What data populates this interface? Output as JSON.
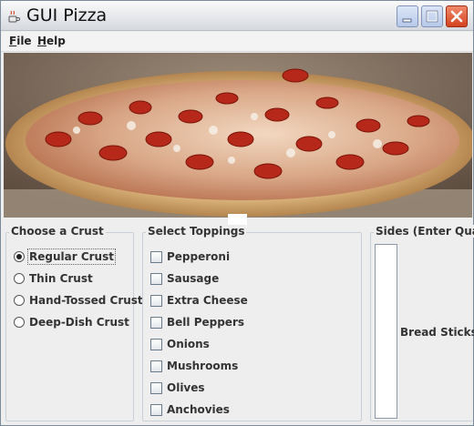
{
  "window": {
    "title": "GUI Pizza",
    "icon": "java-coffee-icon"
  },
  "menubar": {
    "file": "File",
    "help": "Help"
  },
  "image": {
    "subject": "pepperoni-pizza-photo"
  },
  "crust": {
    "title": "Choose a Crust",
    "options": [
      "Regular Crust",
      "Thin Crust",
      "Hand-Tossed Crust",
      "Deep-Dish Crust"
    ],
    "selected": "Regular Crust"
  },
  "toppings": {
    "title": "Select Toppings",
    "options": [
      "Pepperoni",
      "Sausage",
      "Extra Cheese",
      "Bell Peppers",
      "Onions",
      "Mushrooms",
      "Olives",
      "Anchovies"
    ],
    "checked": []
  },
  "sides": {
    "title": "Sides (Enter Quant",
    "field_value": "",
    "item_label": "Bread Sticks"
  },
  "colors": {
    "close_button": "#d4421f",
    "window_bg": "#eeeeee"
  }
}
